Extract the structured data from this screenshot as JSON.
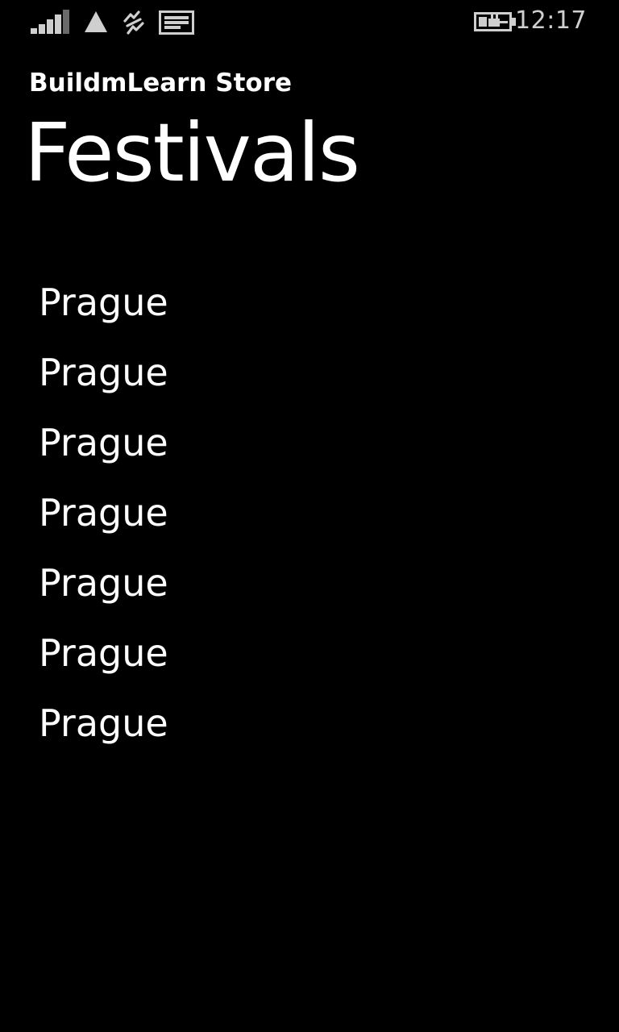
{
  "status_bar": {
    "time": "12:17",
    "icons": [
      "signal-strength-icon",
      "roaming-icon",
      "data-connection-icon",
      "message-icon",
      "battery-charging-icon"
    ],
    "icon_color": "#cfcfcf"
  },
  "header": {
    "app_name": "BuildmLearn Store",
    "page_title": "Festivals"
  },
  "list": {
    "items": [
      {
        "label": "Prague"
      },
      {
        "label": "Prague"
      },
      {
        "label": "Prague"
      },
      {
        "label": "Prague"
      },
      {
        "label": "Prague"
      },
      {
        "label": "Prague"
      },
      {
        "label": "Prague"
      }
    ]
  },
  "theme": {
    "background": "#000000",
    "foreground": "#ffffff"
  }
}
